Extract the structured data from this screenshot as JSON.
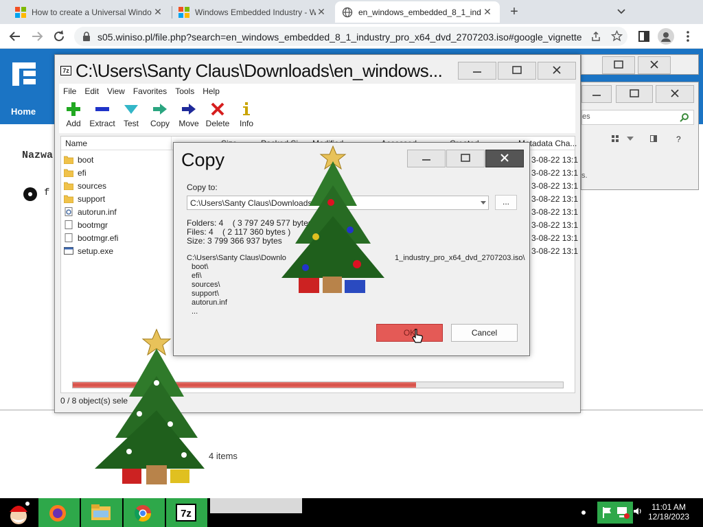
{
  "browser": {
    "tabs": [
      {
        "title": "How to create a Universal Windo",
        "icon": "windows-logo-icon"
      },
      {
        "title": "Windows Embedded Industry - W",
        "icon": "windows-logo-icon"
      },
      {
        "title": "en_windows_embedded_8_1_ind",
        "icon": "globe-icon"
      }
    ],
    "url_host": "s05.winiso.pl",
    "url_path": "/file.php?search=en_windows_embedded_8_1_industry_pro_x64_dvd_2707203.iso#google_vignette"
  },
  "page": {
    "nav_home": "Home",
    "heading_fragment": "Nazwa",
    "file_fragment": "f",
    "search_fragment": "es",
    "side_text_fragment": "s.",
    "items_count": "4 items"
  },
  "zip": {
    "title": "C:\\Users\\Santy Claus\\Downloads\\en_windows...",
    "menu": [
      "File",
      "Edit",
      "View",
      "Favorites",
      "Tools",
      "Help"
    ],
    "tools": [
      {
        "label": "Add",
        "icon": "add-icon",
        "color": "#21a821"
      },
      {
        "label": "Extract",
        "icon": "extract-icon",
        "color": "#1f33c8"
      },
      {
        "label": "Test",
        "icon": "test-icon",
        "color": "#33b6c8"
      },
      {
        "label": "Copy",
        "icon": "copy-icon",
        "color": "#2aa580"
      },
      {
        "label": "Move",
        "icon": "move-icon",
        "color": "#1f2a9a"
      },
      {
        "label": "Delete",
        "icon": "delete-icon",
        "color": "#d61e1e"
      },
      {
        "label": "Info",
        "icon": "info-icon",
        "color": "#c9a400"
      }
    ],
    "columns": {
      "name": "Name",
      "size": "Size",
      "packed": "Packed Si",
      "modified": "Modified",
      "accessed": "Accessed",
      "created": "Created",
      "metadata": "Metadata Cha..."
    },
    "files": [
      {
        "name": "boot",
        "type": "folder",
        "date": "3-08-22 13:1"
      },
      {
        "name": "efi",
        "type": "folder",
        "date": "3-08-22 13:1"
      },
      {
        "name": "sources",
        "type": "folder",
        "date": "3-08-22 13:1"
      },
      {
        "name": "support",
        "type": "folder",
        "date": "3-08-22 13:1"
      },
      {
        "name": "autorun.inf",
        "type": "settings",
        "date": "3-08-22 13:1"
      },
      {
        "name": "bootmgr",
        "type": "file",
        "date": "3-08-22 13:1"
      },
      {
        "name": "bootmgr.efi",
        "type": "file",
        "date": "3-08-22 13:1"
      },
      {
        "name": "setup.exe",
        "type": "exe",
        "date": "3-08-22 13:1"
      }
    ],
    "progress": 0.7,
    "status": "0 / 8 object(s) sele"
  },
  "copy_dialog": {
    "title": "Copy",
    "copy_to_label": "Copy to:",
    "destination": "C:\\Users\\Santy Claus\\Downloads\\w",
    "browse_label": "...",
    "folders": "Folders: 4    ( 3 797 249 577 bytes )",
    "files": "Files: 4    ( 2 117 360 bytes )",
    "size": "Size: 3 799 366 937 bytes",
    "source_path": "C:\\Users\\Santy Claus\\Downlo",
    "source_path_tail": "1_industry_pro_x64_dvd_2707203.iso\\",
    "items": [
      "boot\\",
      "efi\\",
      "sources\\",
      "support\\",
      "autorun.inf",
      "..."
    ],
    "ok_label": "OK",
    "cancel_label": "Cancel"
  },
  "taskbar": {
    "time": "11:01 AM",
    "date": "12/18/2023",
    "apps": [
      "santa-icon",
      "firefox-icon",
      "file-explorer-icon",
      "chrome-icon",
      "7zip-icon"
    ]
  }
}
